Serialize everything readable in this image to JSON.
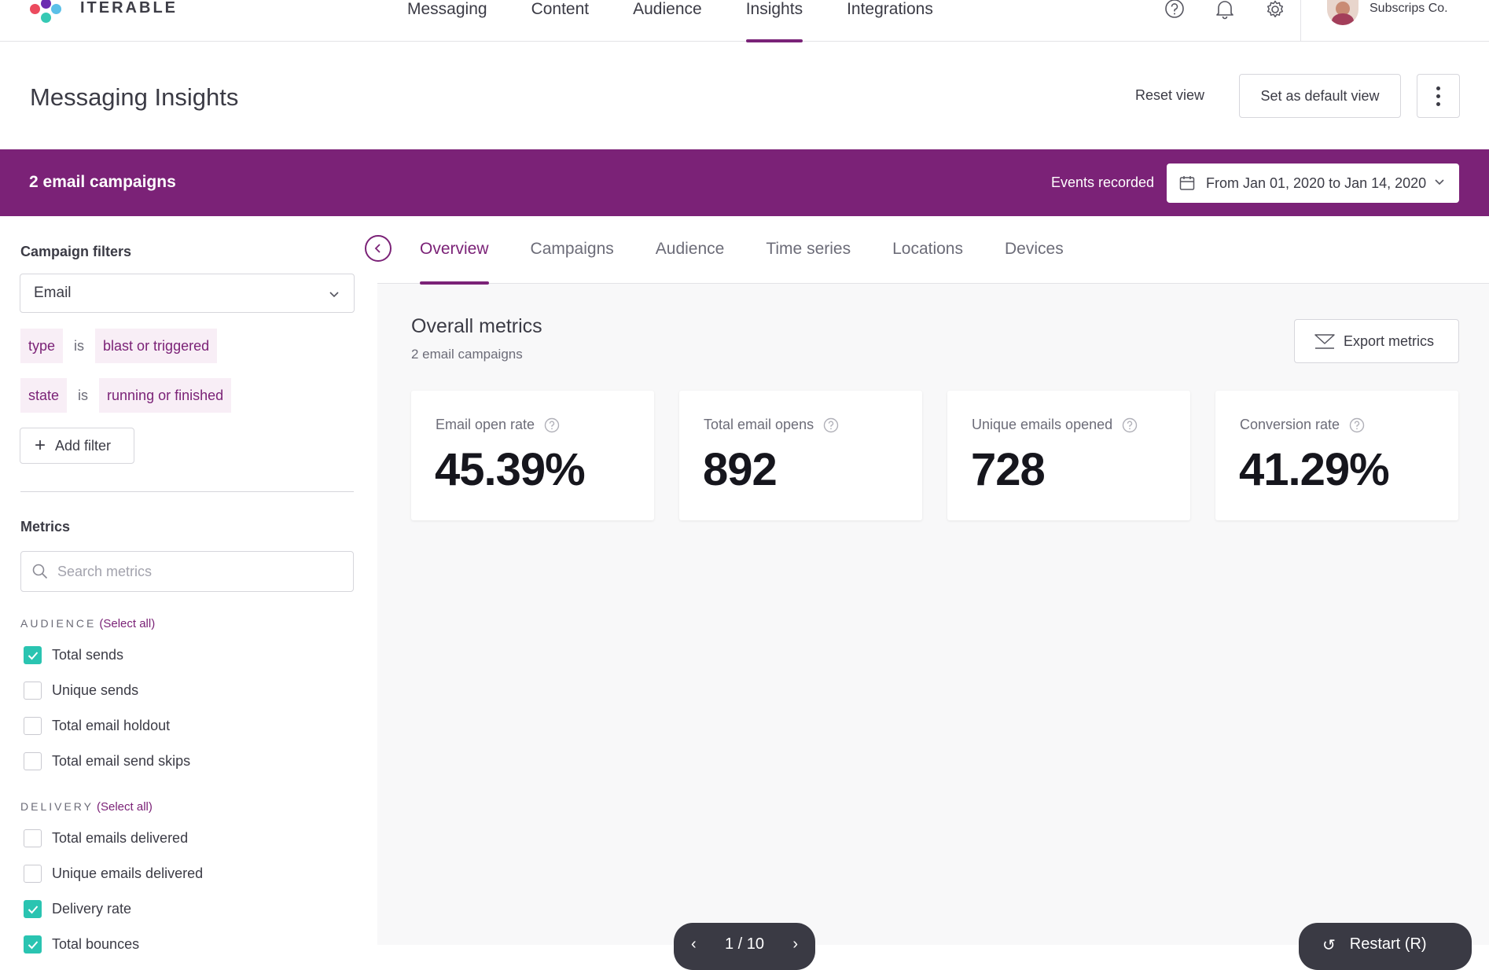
{
  "brand": {
    "name": "ITERABLE"
  },
  "nav": {
    "items": [
      {
        "label": "Messaging"
      },
      {
        "label": "Content"
      },
      {
        "label": "Audience"
      },
      {
        "label": "Insights",
        "active": true
      },
      {
        "label": "Integrations"
      }
    ],
    "icons": [
      "help-icon",
      "bell-icon",
      "gear-icon"
    ],
    "account_name": "Subscrips Co."
  },
  "header": {
    "title": "Messaging Insights",
    "reset_label": "Reset view",
    "default_label": "Set as default view"
  },
  "banner": {
    "title": "2 email campaigns",
    "events_label": "Events recorded",
    "date_range": "From Jan 01, 2020 to Jan 14, 2020"
  },
  "sidebar": {
    "filters_heading": "Campaign filters",
    "channel_value": "Email",
    "filters": [
      {
        "field": "type",
        "op": "is",
        "value": "blast or triggered"
      },
      {
        "field": "state",
        "op": "is",
        "value": "running or finished"
      }
    ],
    "add_filter_label": "Add filter",
    "metrics_heading": "Metrics",
    "search_placeholder": "Search metrics",
    "groups": [
      {
        "label": "AUDIENCE",
        "select_all": "(Select all)",
        "items": [
          {
            "label": "Total sends",
            "checked": true
          },
          {
            "label": "Unique sends",
            "checked": false
          },
          {
            "label": "Total email holdout",
            "checked": false
          },
          {
            "label": "Total email send skips",
            "checked": false
          }
        ]
      },
      {
        "label": "DELIVERY",
        "select_all": "(Select all)",
        "items": [
          {
            "label": "Total emails delivered",
            "checked": false
          },
          {
            "label": "Unique emails delivered",
            "checked": false
          },
          {
            "label": "Delivery rate",
            "checked": true
          },
          {
            "label": "Total bounces",
            "checked": true
          }
        ]
      }
    ]
  },
  "main": {
    "tabs": [
      {
        "label": "Overview",
        "active": true
      },
      {
        "label": "Campaigns"
      },
      {
        "label": "Audience"
      },
      {
        "label": "Time series"
      },
      {
        "label": "Locations"
      },
      {
        "label": "Devices"
      }
    ],
    "section_title": "Overall metrics",
    "section_subtitle": "2 email campaigns",
    "export_label": "Export metrics",
    "cards": [
      {
        "label": "Email open rate",
        "value": "45.39%"
      },
      {
        "label": "Total email opens",
        "value": "892"
      },
      {
        "label": "Unique emails opened",
        "value": "728"
      },
      {
        "label": "Conversion rate",
        "value": "41.29%"
      }
    ]
  },
  "footer": {
    "pager_text": "1 / 10",
    "restart_label": "Restart (R)"
  },
  "colors": {
    "brand_purple": "#7b2277",
    "check_teal": "#2ac4b1",
    "text": "#3b3b45"
  }
}
